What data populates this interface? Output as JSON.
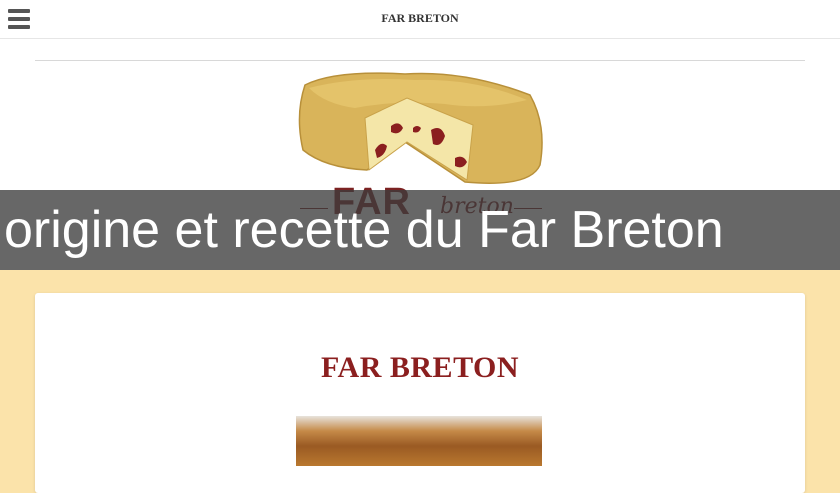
{
  "header": {
    "site_title": "FAR BRETON"
  },
  "logo": {
    "word_far": "FAR",
    "word_breton": "breton"
  },
  "banner": {
    "title": "origine et recette du Far Breton"
  },
  "article": {
    "heading": "FAR BRETON"
  },
  "icons": {
    "menu": "hamburger-menu-icon"
  },
  "colors": {
    "page_background": "#fbe3aa",
    "brand_red": "#8b1f1f",
    "banner_overlay": "#3c3c3c"
  }
}
